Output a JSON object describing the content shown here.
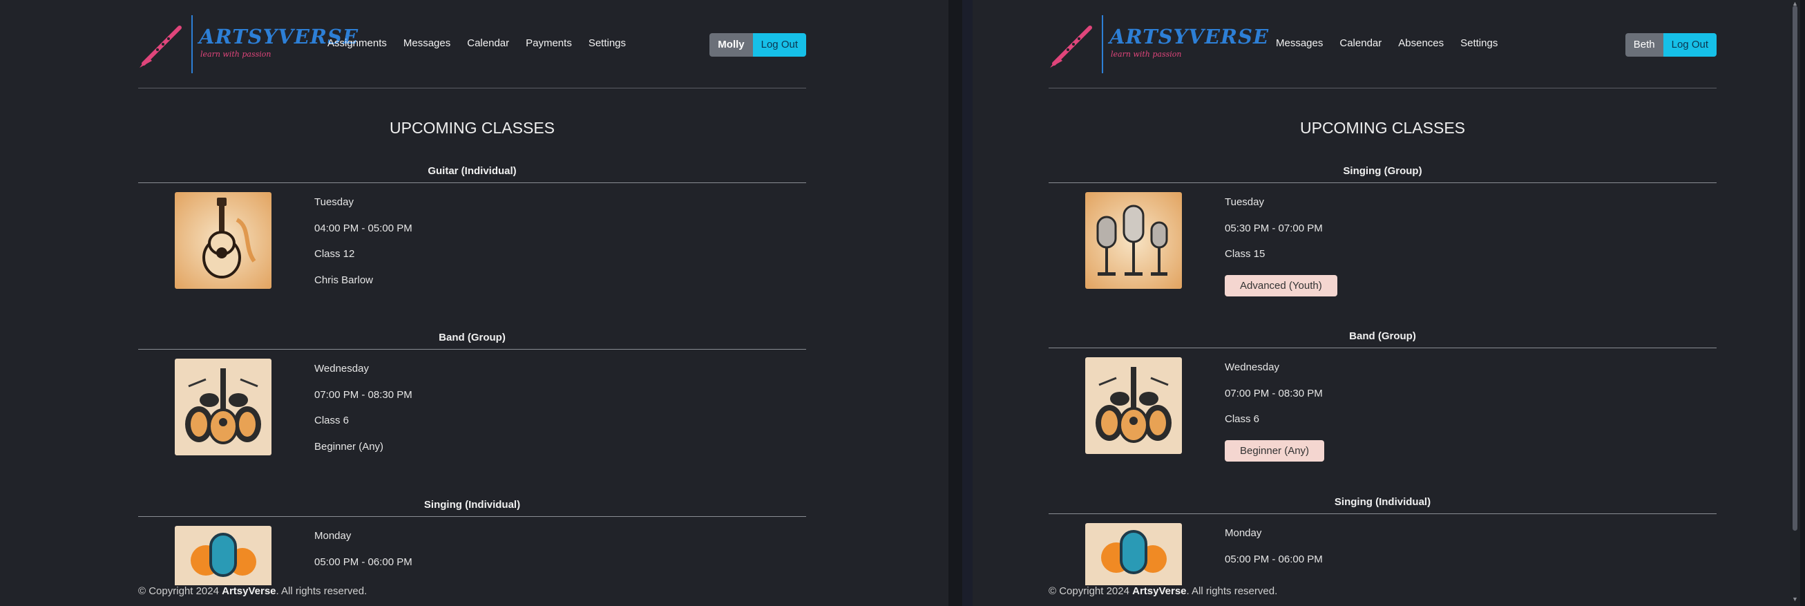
{
  "brand": {
    "title": "ARTSYVERSE",
    "tagline": "learn with passion"
  },
  "colors": {
    "accent_blue": "#16c0e8",
    "brand_blue": "#2d7fd6",
    "brand_pink": "#e0457b",
    "level_badge": "#f4d6d0"
  },
  "left": {
    "nav": [
      "Assignments",
      "Messages",
      "Calendar",
      "Payments",
      "Settings"
    ],
    "user": "Molly",
    "logout": "Log Out",
    "heading": "UPCOMING CLASSES",
    "classes": [
      {
        "name": "Guitar (Individual)",
        "day": "Tuesday",
        "time": "04:00 PM - 05:00 PM",
        "room": "Class 12",
        "extra": "Chris Barlow",
        "icon": "guitar-icon"
      },
      {
        "name": "Band (Group)",
        "day": "Wednesday",
        "time": "07:00 PM - 08:30 PM",
        "room": "Class 6",
        "extra": "Beginner (Any)",
        "icon": "band-icon"
      },
      {
        "name": "Singing (Individual)",
        "day": "Monday",
        "time": "05:00 PM - 06:00 PM",
        "icon": "microphone-icon"
      }
    ],
    "footer": {
      "prefix": "© Copyright 2024 ",
      "brand": "ArtsyVerse",
      "suffix": ". All rights reserved."
    }
  },
  "right": {
    "nav": [
      "Messages",
      "Calendar",
      "Absences",
      "Settings"
    ],
    "user": "Beth",
    "logout": "Log Out",
    "heading": "UPCOMING CLASSES",
    "classes": [
      {
        "name": "Singing (Group)",
        "day": "Tuesday",
        "time": "05:30 PM - 07:00 PM",
        "room": "Class 15",
        "level": "Advanced (Youth)",
        "icon": "microphones-icon"
      },
      {
        "name": "Band (Group)",
        "day": "Wednesday",
        "time": "07:00 PM - 08:30 PM",
        "room": "Class 6",
        "level": "Beginner (Any)",
        "icon": "band-icon"
      },
      {
        "name": "Singing (Individual)",
        "day": "Monday",
        "time": "05:00 PM - 06:00 PM",
        "icon": "microphone-icon"
      }
    ],
    "footer": {
      "prefix": "© Copyright 2024 ",
      "brand": "ArtsyVerse",
      "suffix": ". All rights reserved."
    }
  }
}
